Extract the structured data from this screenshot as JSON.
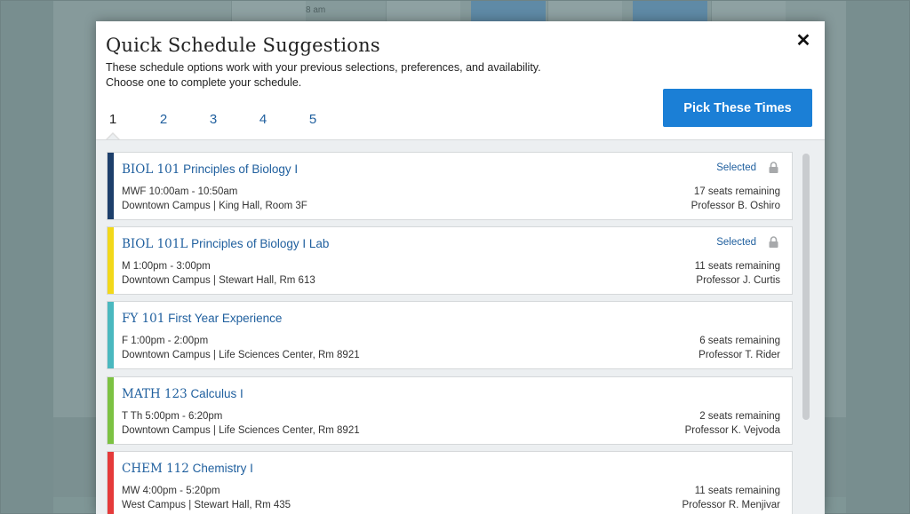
{
  "background": {
    "time_label": "8 am"
  },
  "modal": {
    "title": "Quick Schedule Suggestions",
    "subtitle_line1": "These schedule options work with your previous selections, preferences, and availability.",
    "subtitle_line2": "Choose one to complete your schedule.",
    "close_icon": "close-icon",
    "pick_button": "Pick These Times",
    "tabs": [
      "1",
      "2",
      "3",
      "4",
      "5"
    ],
    "active_tab": "1"
  },
  "courses": [
    {
      "code": "BIOL 101",
      "name": "Principles of Biology I",
      "schedule": "MWF 10:00am - 10:50am",
      "location": "Downtown Campus | King Hall, Room 3F",
      "seats": "17 seats remaining",
      "professor": "Professor B. Oshiro",
      "status": "Selected",
      "locked": true,
      "color": "#1d3f6b"
    },
    {
      "code": "BIOL 101L",
      "name": "Principles of Biology I Lab",
      "schedule": "M 1:00pm - 3:00pm",
      "location": "Downtown Campus | Stewart Hall, Rm 613",
      "seats": "11 seats remaining",
      "professor": "Professor J. Curtis",
      "status": "Selected",
      "locked": true,
      "color": "#f2d81a"
    },
    {
      "code": "FY 101",
      "name": "First Year Experience",
      "schedule": "F 1:00pm - 2:00pm",
      "location": "Downtown Campus | Life Sciences Center, Rm 8921",
      "seats": "6 seats remaining",
      "professor": "Professor T. Rider",
      "status": "",
      "locked": false,
      "color": "#4ab8bf"
    },
    {
      "code": "MATH 123",
      "name": "Calculus I",
      "schedule": "T Th 5:00pm - 6:20pm",
      "location": "Downtown Campus | Life Sciences Center, Rm 8921",
      "seats": "2 seats remaining",
      "professor": "Professor K. Vejvoda",
      "status": "",
      "locked": false,
      "color": "#7cc242"
    },
    {
      "code": "CHEM 112",
      "name": "Chemistry I",
      "schedule": "MW 4:00pm - 5:20pm",
      "location": "West Campus | Stewart Hall, Rm 435",
      "seats": "11 seats remaining",
      "professor": "Professor R. Menjivar",
      "status": "",
      "locked": false,
      "color": "#e53a3a"
    }
  ]
}
